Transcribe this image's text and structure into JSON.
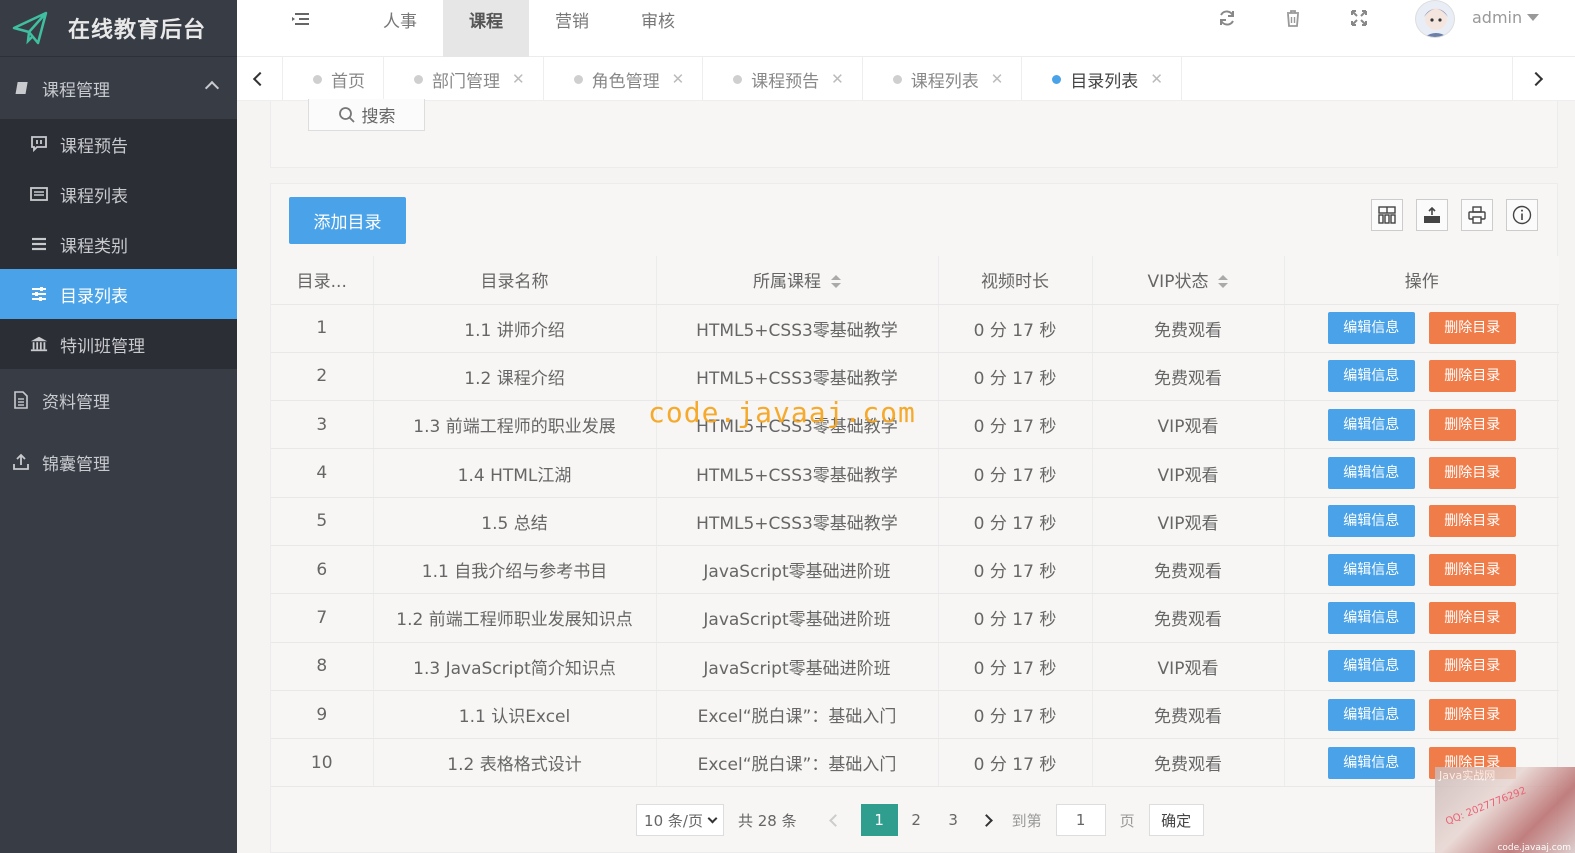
{
  "app": {
    "title": "在线教育后台"
  },
  "sidebar": {
    "groups": [
      {
        "label": "课程管理",
        "icon": "book-icon",
        "expanded": true,
        "items": [
          {
            "label": "课程预告",
            "icon": "comment-icon"
          },
          {
            "label": "课程列表",
            "icon": "list-card-icon"
          },
          {
            "label": "课程类别",
            "icon": "menu-lines-icon"
          },
          {
            "label": "目录列表",
            "icon": "sliders-icon",
            "active": true
          },
          {
            "label": "特训班管理",
            "icon": "bank-icon"
          }
        ]
      },
      {
        "label": "资料管理",
        "icon": "document-icon"
      },
      {
        "label": "锦囊管理",
        "icon": "upload-icon"
      }
    ]
  },
  "topnav": {
    "items": [
      "人事",
      "课程",
      "营销",
      "审核"
    ],
    "active_index": 1,
    "user": "admin"
  },
  "tabs": [
    {
      "label": "首页",
      "closable": false
    },
    {
      "label": "部门管理",
      "closable": true
    },
    {
      "label": "角色管理",
      "closable": true
    },
    {
      "label": "课程预告",
      "closable": true
    },
    {
      "label": "课程列表",
      "closable": true
    },
    {
      "label": "目录列表",
      "closable": true,
      "active": true
    }
  ],
  "search": {
    "label": "搜索"
  },
  "toolbar": {
    "add_label": "添加目录"
  },
  "table": {
    "headers": [
      "目录...",
      "目录名称",
      "所属课程",
      "视频时长",
      "VIP状态",
      "操作"
    ],
    "rows": [
      [
        "1",
        "1.1 讲师介绍",
        "HTML5+CSS3零基础教学",
        "0 分 17 秒",
        "免费观看"
      ],
      [
        "2",
        "1.2 课程介绍",
        "HTML5+CSS3零基础教学",
        "0 分 17 秒",
        "免费观看"
      ],
      [
        "3",
        "1.3 前端工程师的职业发展",
        "HTML5+CSS3零基础教学",
        "0 分 17 秒",
        "VIP观看"
      ],
      [
        "4",
        "1.4 HTML江湖",
        "HTML5+CSS3零基础教学",
        "0 分 17 秒",
        "VIP观看"
      ],
      [
        "5",
        "1.5 总结",
        "HTML5+CSS3零基础教学",
        "0 分 17 秒",
        "VIP观看"
      ],
      [
        "6",
        "1.1 自我介绍与参考书目",
        "JavaScript零基础进阶班",
        "0 分 17 秒",
        "免费观看"
      ],
      [
        "7",
        "1.2 前端工程师职业发展知识点",
        "JavaScript零基础进阶班",
        "0 分 17 秒",
        "免费观看"
      ],
      [
        "8",
        "1.3 JavaScript简介知识点",
        "JavaScript零基础进阶班",
        "0 分 17 秒",
        "VIP观看"
      ],
      [
        "9",
        "1.1 认识Excel",
        "Excel“脱白课”：基础入门",
        "0 分 17 秒",
        "免费观看"
      ],
      [
        "10",
        "1.2 表格格式设计",
        "Excel“脱白课”：基础入门",
        "0 分 17 秒",
        "免费观看"
      ]
    ],
    "edit_label": "编辑信息",
    "delete_label": "删除目录"
  },
  "pager": {
    "page_size": "10 条/页",
    "total": "共 28 条",
    "pages": [
      "1",
      "2",
      "3"
    ],
    "current": "1",
    "goto_label": "到第",
    "goto_value": "1",
    "page_suffix": "页",
    "confirm_label": "确定"
  },
  "watermark": {
    "text": "code.javaaj.com"
  },
  "corner": {
    "t1": "Java实战网",
    "t2": "QQ: 2027776292",
    "t3": "code.javaaj.com"
  },
  "colors": {
    "primary": "#4aa3e8",
    "danger": "#f07c4a",
    "sidebar": "#383c45",
    "pager_active": "#2f9e8e"
  }
}
